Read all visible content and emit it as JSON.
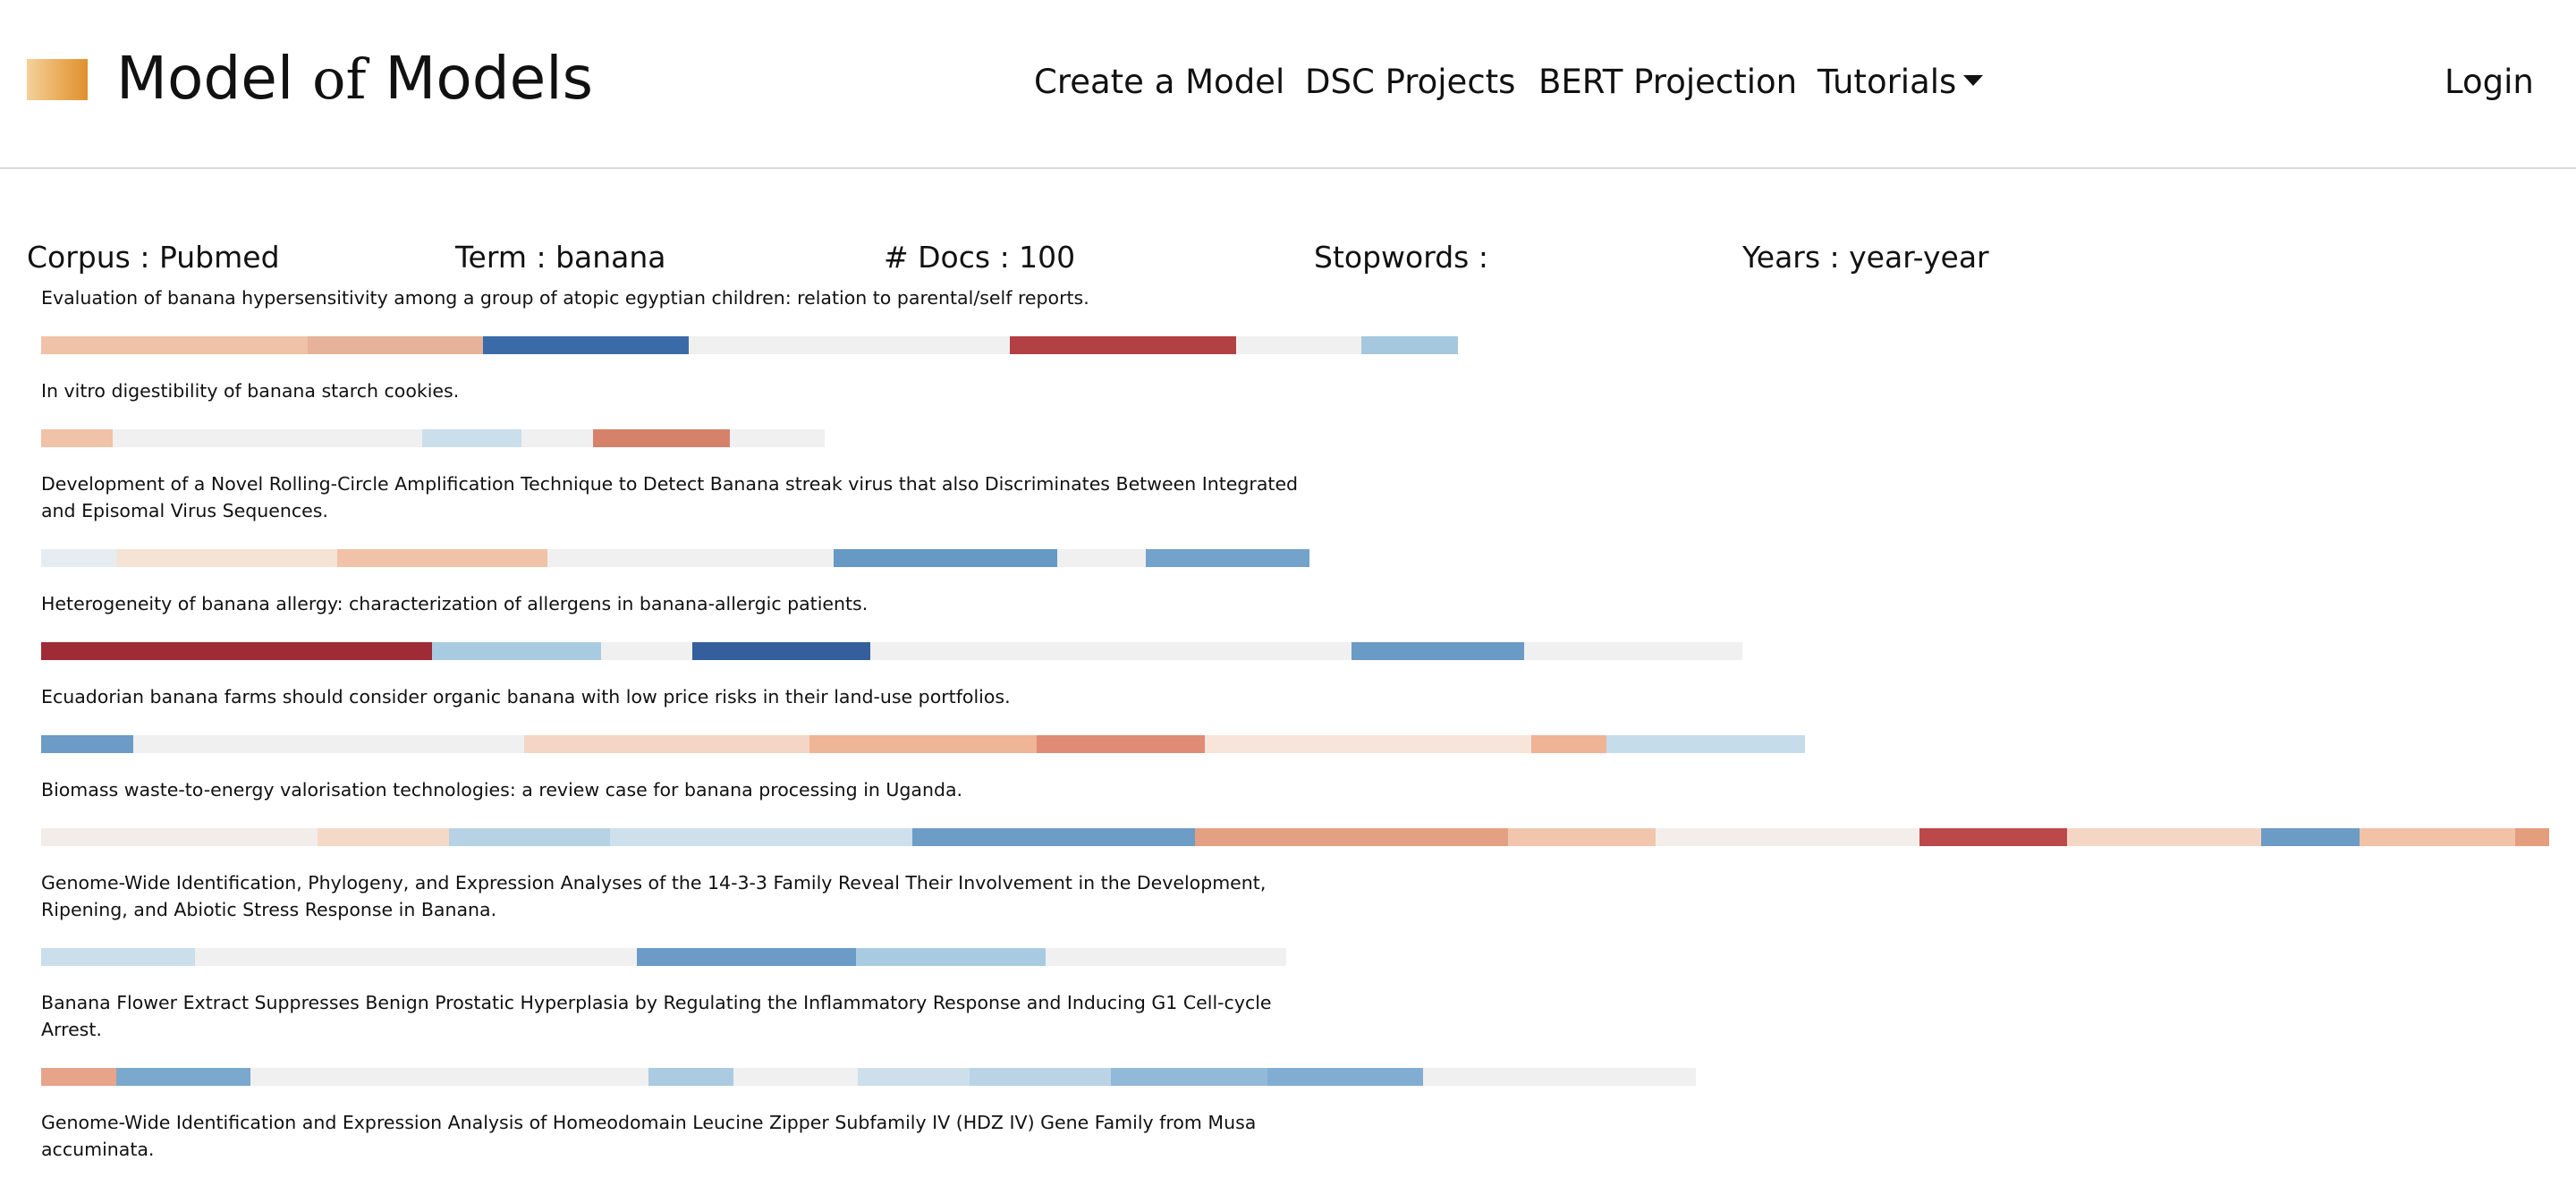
{
  "app": {
    "brand_main": "Model ",
    "brand_of": "of",
    "brand_end": " Models",
    "logo_colors": [
      "#f4d19a",
      "#e9a955",
      "#e0902f"
    ]
  },
  "nav": {
    "items": [
      {
        "label": "Create a Model"
      },
      {
        "label": "DSC Projects"
      },
      {
        "label": "BERT Projection"
      },
      {
        "label": "Tutorials"
      }
    ],
    "login": "Login"
  },
  "meta": {
    "corpus": "Corpus : Pubmed",
    "term": "Term : banana",
    "docs": "# Docs : 100",
    "stopwords": "Stopwords :",
    "years": "Years : year-year"
  },
  "documents": [
    {
      "title": "Evaluation of banana hypersensitivity among a group of atopic egyptian children: relation to parental/self reports.",
      "segments": [
        {
          "start": 0,
          "end": 298,
          "color": "#f0c2a7"
        },
        {
          "start": 298,
          "end": 494,
          "color": "#e6b29a"
        },
        {
          "start": 494,
          "end": 724,
          "color": "#3b6aa8"
        },
        {
          "start": 724,
          "end": 1083,
          "color": "#f0f0f0"
        },
        {
          "start": 1083,
          "end": 1336,
          "color": "#b24144"
        },
        {
          "start": 1336,
          "end": 1476,
          "color": "#f0f0f0"
        },
        {
          "start": 1476,
          "end": 1584,
          "color": "#a6c8de"
        }
      ]
    },
    {
      "title": "In vitro digestibility of banana starch cookies.",
      "segments": [
        {
          "start": 0,
          "end": 80,
          "color": "#f0c2a7"
        },
        {
          "start": 80,
          "end": 426,
          "color": "#f0f0f0"
        },
        {
          "start": 426,
          "end": 537,
          "color": "#cadeeb"
        },
        {
          "start": 537,
          "end": 617,
          "color": "#f0f0f0"
        },
        {
          "start": 617,
          "end": 770,
          "color": "#d6826a"
        },
        {
          "start": 770,
          "end": 876,
          "color": "#f0f0f0"
        }
      ]
    },
    {
      "title": "Development of a Novel Rolling-Circle Amplification Technique to Detect Banana streak virus that also Discriminates Between Integrated and Episomal Virus Sequences.",
      "segments": [
        {
          "start": 0,
          "end": 84,
          "color": "#e6edf2"
        },
        {
          "start": 84,
          "end": 331,
          "color": "#f5e3d6"
        },
        {
          "start": 331,
          "end": 566,
          "color": "#f0c2a7"
        },
        {
          "start": 566,
          "end": 886,
          "color": "#f0f0f0"
        },
        {
          "start": 886,
          "end": 1136,
          "color": "#6699c4"
        },
        {
          "start": 1136,
          "end": 1235,
          "color": "#f0f0f0"
        },
        {
          "start": 1235,
          "end": 1418,
          "color": "#73a2ca"
        }
      ]
    },
    {
      "title": "Heterogeneity of banana allergy: characterization of allergens in banana-allergic patients.",
      "segments": [
        {
          "start": 0,
          "end": 437,
          "color": "#9e2b35"
        },
        {
          "start": 437,
          "end": 626,
          "color": "#a9cbe2"
        },
        {
          "start": 626,
          "end": 728,
          "color": "#f0f0f0"
        },
        {
          "start": 728,
          "end": 927,
          "color": "#345f9c"
        },
        {
          "start": 927,
          "end": 1465,
          "color": "#f0f0f0"
        },
        {
          "start": 1465,
          "end": 1658,
          "color": "#6a9ac6"
        },
        {
          "start": 1658,
          "end": 1902,
          "color": "#f0f0f0"
        }
      ]
    },
    {
      "title": "Ecuadorian banana farms should consider organic banana with low price risks in their land-use portfolios.",
      "segments": [
        {
          "start": 0,
          "end": 103,
          "color": "#6b9bc6"
        },
        {
          "start": 103,
          "end": 540,
          "color": "#f0f0f0"
        },
        {
          "start": 540,
          "end": 859,
          "color": "#f5d6c6"
        },
        {
          "start": 859,
          "end": 1113,
          "color": "#eeb597"
        },
        {
          "start": 1113,
          "end": 1301,
          "color": "#df8b76"
        },
        {
          "start": 1301,
          "end": 1666,
          "color": "#f7e4da"
        },
        {
          "start": 1666,
          "end": 1750,
          "color": "#efb396"
        },
        {
          "start": 1750,
          "end": 1972,
          "color": "#c5dcea"
        }
      ]
    },
    {
      "title": "Biomass waste-to-energy valorisation technologies: a review case for banana processing in Uganda.",
      "segments": [
        {
          "start": 0,
          "end": 309,
          "color": "#f3ede9"
        },
        {
          "start": 309,
          "end": 456,
          "color": "#f5d9c8"
        },
        {
          "start": 456,
          "end": 636,
          "color": "#b7d2e5"
        },
        {
          "start": 636,
          "end": 974,
          "color": "#cde0ec"
        },
        {
          "start": 974,
          "end": 1290,
          "color": "#6d9dc7"
        },
        {
          "start": 1290,
          "end": 1640,
          "color": "#e3a082"
        },
        {
          "start": 1640,
          "end": 1805,
          "color": "#f1c6ad"
        },
        {
          "start": 1805,
          "end": 2100,
          "color": "#f4eeeb"
        },
        {
          "start": 2100,
          "end": 2265,
          "color": "#bb494b"
        },
        {
          "start": 2265,
          "end": 2482,
          "color": "#f5d6c5"
        },
        {
          "start": 2482,
          "end": 2592,
          "color": "#6c9bc5"
        },
        {
          "start": 2592,
          "end": 2766,
          "color": "#f1c2a6"
        },
        {
          "start": 2766,
          "end": 2804,
          "color": "#e49e7d"
        }
      ]
    },
    {
      "title": "Genome-Wide Identification, Phylogeny, and Expression Analyses of the 14-3-3 Family Reveal Their Involvement in the Development, Ripening, and Abiotic Stress Response in Banana.",
      "segments": [
        {
          "start": 0,
          "end": 172,
          "color": "#cadeeb"
        },
        {
          "start": 172,
          "end": 666,
          "color": "#f0f0f0"
        },
        {
          "start": 666,
          "end": 911,
          "color": "#6b9bc6"
        },
        {
          "start": 911,
          "end": 1123,
          "color": "#a9cbe2"
        },
        {
          "start": 1123,
          "end": 1392,
          "color": "#f0f0f0"
        }
      ]
    },
    {
      "title": "Banana Flower Extract Suppresses Benign Prostatic Hyperplasia by Regulating the Inflammatory Response and Inducing G1 Cell-cycle Arrest.",
      "segments": [
        {
          "start": 0,
          "end": 84,
          "color": "#e6a48a"
        },
        {
          "start": 84,
          "end": 234,
          "color": "#7ba8cd"
        },
        {
          "start": 234,
          "end": 679,
          "color": "#f0f0f0"
        },
        {
          "start": 679,
          "end": 774,
          "color": "#aacbe2"
        },
        {
          "start": 774,
          "end": 913,
          "color": "#f0f0f0"
        },
        {
          "start": 913,
          "end": 1038,
          "color": "#cddfeb"
        },
        {
          "start": 1038,
          "end": 1196,
          "color": "#bad4e6"
        },
        {
          "start": 1196,
          "end": 1371,
          "color": "#93b9d8"
        },
        {
          "start": 1371,
          "end": 1545,
          "color": "#82add2"
        },
        {
          "start": 1545,
          "end": 1850,
          "color": "#f0f0f0"
        }
      ]
    },
    {
      "title": "Genome-Wide Identification and Expression Analysis of Homeodomain Leucine Zipper Subfamily IV (HDZ IV) Gene Family from Musa accuminata.",
      "segments": []
    }
  ]
}
